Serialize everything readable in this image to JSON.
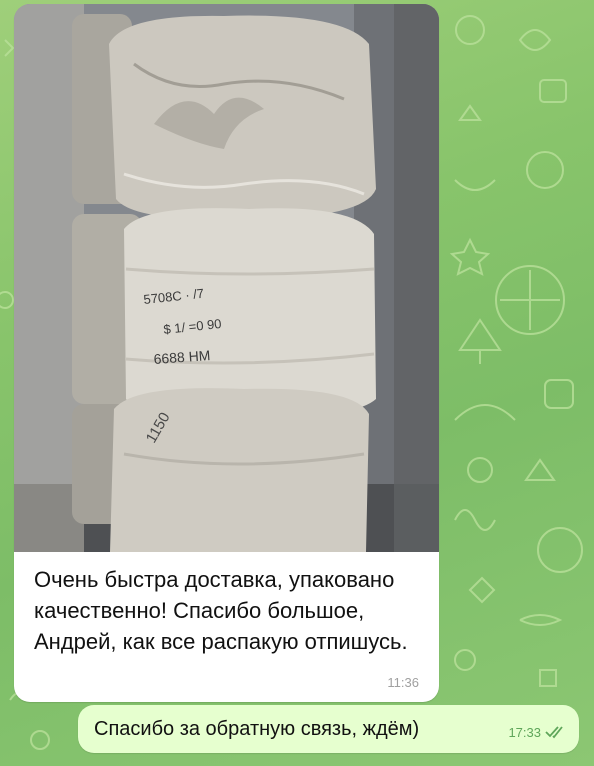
{
  "chat": {
    "incoming": {
      "text": "Очень быстра доставка, упаковано качественно! Спасибо большое, Андрей, как все распакую отпишусь.",
      "time": "11:36",
      "photo_subject": "wrapped-bales-photo"
    },
    "outgoing": {
      "text": "Спасибо за обратную связь, ждём)",
      "time": "17:33",
      "status_icon": "double-check-icon"
    }
  },
  "colors": {
    "wallpaper": "#88c46b",
    "incoming_bubble": "#ffffff",
    "outgoing_bubble": "#e6ffcf",
    "outgoing_meta": "#5fa65a"
  }
}
